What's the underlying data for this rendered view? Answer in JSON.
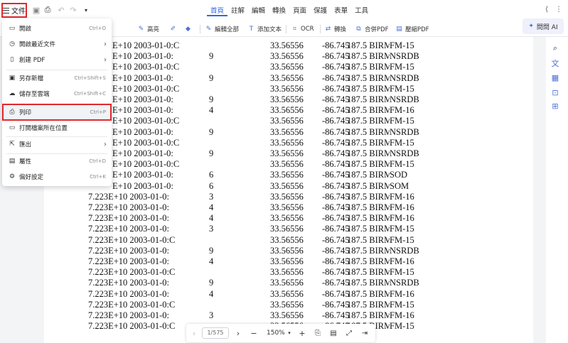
{
  "titlebar": {
    "file_label": "文件",
    "tabs": [
      "首頁",
      "註解",
      "編輯",
      "轉換",
      "頁面",
      "保護",
      "表單",
      "工具"
    ],
    "active_tab": "首頁"
  },
  "toolbar": {
    "highlight": "高亮",
    "edit_all": "編輯全部",
    "add_text": "添加文本",
    "ocr": "OCR",
    "convert": "轉換",
    "merge_pdf": "合併PDF",
    "compress_pdf": "壓縮PDF",
    "ask_ai": "問問 AI"
  },
  "file_menu": {
    "items": [
      {
        "label": "開啟",
        "shortcut": "Ctrl+O",
        "icon": "folder-open-icon"
      },
      {
        "label": "開啟最近文件",
        "arrow": "›",
        "icon": "recent-icon"
      },
      {
        "label": "創建 PDF",
        "arrow": "›",
        "icon": "create-pdf-icon"
      },
      {
        "label": "另存新檔",
        "shortcut": "Ctrl+Shift+S",
        "icon": "save-as-icon"
      },
      {
        "label": "儲存至雲端",
        "shortcut": "Ctrl+Shift+C",
        "icon": "cloud-save-icon"
      },
      {
        "label": "列印",
        "shortcut": "Ctrl+P",
        "icon": "print-icon"
      },
      {
        "label": "打開檔案所在位置",
        "icon": "folder-location-icon"
      },
      {
        "label": "匯出",
        "arrow": "›",
        "icon": "export-icon"
      },
      {
        "label": "屬性",
        "shortcut": "Ctrl+D",
        "icon": "properties-icon"
      },
      {
        "label": "偏好設定",
        "shortcut": "Ctrl+K",
        "icon": "preferences-icon"
      }
    ]
  },
  "document": {
    "rows": [
      [
        "E+10 2003-01-0:C",
        "",
        "33.56556",
        "-86.745",
        "187.5 BIRMINGHAM",
        "FM-15"
      ],
      [
        "E+10 2003-01-0:",
        "9",
        "33.56556",
        "-86.745",
        "187.5 BIRMINGHAM",
        "NSRDB"
      ],
      [
        "E+10 2003-01-0:C",
        "",
        "33.56556",
        "-86.745",
        "187.5 BIRMINGHAM",
        "FM-15"
      ],
      [
        "E+10 2003-01-0:",
        "9",
        "33.56556",
        "-86.745",
        "187.5 BIRMINGHAM",
        "NSRDB"
      ],
      [
        "E+10 2003-01-0:C",
        "",
        "33.56556",
        "-86.745",
        "187.5 BIRMINGHAM",
        "FM-15"
      ],
      [
        "E+10 2003-01-0:",
        "9",
        "33.56556",
        "-86.745",
        "187.5 BIRMINGHAM",
        "NSRDB"
      ],
      [
        "E+10 2003-01-0:",
        "4",
        "33.56556",
        "-86.745",
        "187.5 BIRMINGHAM",
        "FM-16"
      ],
      [
        "E+10 2003-01-0:C",
        "",
        "33.56556",
        "-86.745",
        "187.5 BIRMINGHAM",
        "FM-15"
      ],
      [
        "E+10 2003-01-0:",
        "9",
        "33.56556",
        "-86.745",
        "187.5 BIRMINGHAM",
        "NSRDB"
      ],
      [
        "E+10 2003-01-0:C",
        "",
        "33.56556",
        "-86.745",
        "187.5 BIRMINGHAM",
        "FM-15"
      ],
      [
        "E+10 2003-01-0:",
        "9",
        "33.56556",
        "-86.745",
        "187.5 BIRMINGHAM",
        "NSRDB"
      ],
      [
        "E+10 2003-01-0:C",
        "",
        "33.56556",
        "-86.745",
        "187.5 BIRMINGHAM",
        "FM-15"
      ],
      [
        "E+10 2003-01-0:",
        "6",
        "33.56556",
        "-86.745",
        "187.5 BIRMINGHAM",
        "SOD"
      ],
      [
        "E+10 2003-01-0:",
        "6",
        "33.56556",
        "-86.745",
        "187.5 BIRMINGHAM",
        "SOM"
      ],
      [
        "7.223E+10 2003-01-0:",
        "3",
        "33.56556",
        "-86.745",
        "187.5 BIRMINGHAM",
        "FM-16"
      ],
      [
        "7.223E+10 2003-01-0:",
        "4",
        "33.56556",
        "-86.745",
        "187.5 BIRMINGHAM",
        "FM-16"
      ],
      [
        "7.223E+10 2003-01-0:",
        "4",
        "33.56556",
        "-86.745",
        "187.5 BIRMINGHAM",
        "FM-16"
      ],
      [
        "7.223E+10 2003-01-0:",
        "3",
        "33.56556",
        "-86.745",
        "187.5 BIRMINGHAM",
        "FM-15"
      ],
      [
        "7.223E+10 2003-01-0:C",
        "",
        "33.56556",
        "-86.745",
        "187.5 BIRMINGHAM",
        "FM-15"
      ],
      [
        "7.223E+10 2003-01-0:",
        "9",
        "33.56556",
        "-86.745",
        "187.5 BIRMINGHAM",
        "NSRDB"
      ],
      [
        "7.223E+10 2003-01-0:",
        "4",
        "33.56556",
        "-86.745",
        "187.5 BIRMINGHAM",
        "FM-16"
      ],
      [
        "7.223E+10 2003-01-0:C",
        "",
        "33.56556",
        "-86.745",
        "187.5 BIRMINGHAM",
        "FM-15"
      ],
      [
        "7.223E+10 2003-01-0:",
        "9",
        "33.56556",
        "-86.745",
        "187.5 BIRMINGHAM",
        "NSRDB"
      ],
      [
        "7.223E+10 2003-01-0:",
        "4",
        "33.56556",
        "-86.745",
        "187.5 BIRMINGHAM",
        "FM-16"
      ],
      [
        "7.223E+10 2003-01-0:C",
        "",
        "33.56556",
        "-86.745",
        "187.5 BIRMINGHAM",
        "FM-15"
      ],
      [
        "7.223E+10 2003-01-0:",
        "3",
        "33.56556",
        "-86.745",
        "187.5 BIRMINGHAM",
        "FM-16"
      ],
      [
        "7.223E+10 2003-01-0:C",
        "",
        "33.56556",
        "-86.745",
        "187.5 BIRMINGHAM",
        "FM-15"
      ]
    ]
  },
  "pagebar": {
    "page": "1/575",
    "zoom": "150%"
  },
  "colors": {
    "accent": "#3366e6",
    "highlight_border": "#e0292f"
  }
}
